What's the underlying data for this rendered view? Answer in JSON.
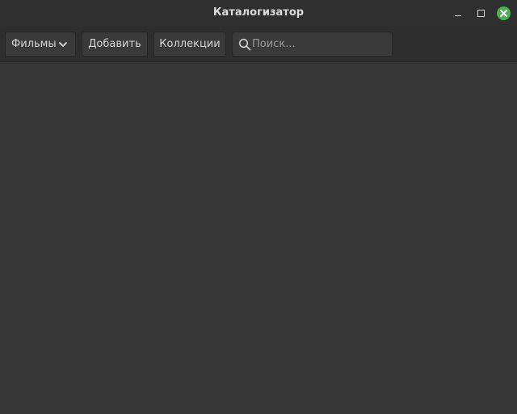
{
  "window": {
    "title": "Каталогизатор"
  },
  "toolbar": {
    "category_selected": "Фильмы",
    "add_label": "Добавить",
    "collections_label": "Коллекции",
    "search_placeholder": "Поиск..."
  },
  "icons": {
    "minimize": "minimize-icon",
    "maximize": "maximize-icon",
    "close": "close-icon",
    "dropdown": "chevron-down-icon",
    "search": "search-icon"
  },
  "colors": {
    "close_button": "#4caf50",
    "background": "#363636",
    "toolbar": "#2e2e2e"
  }
}
